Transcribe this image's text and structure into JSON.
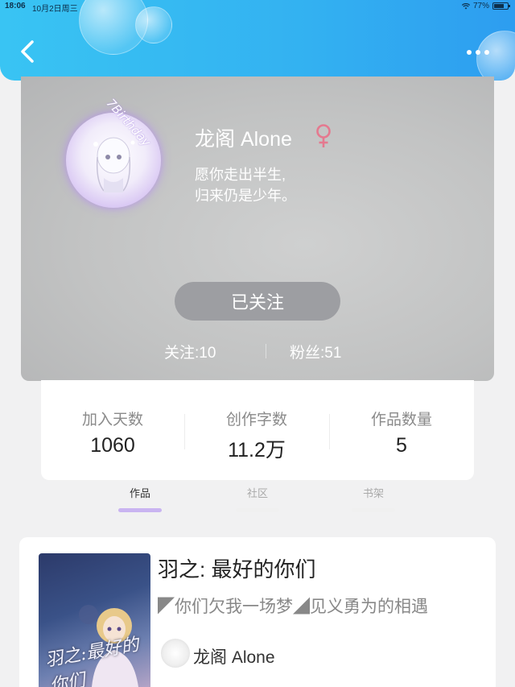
{
  "status_bar": {
    "time": "18:06",
    "date": "10月2日周三",
    "battery": "77%",
    "battery_level": 0.77
  },
  "header": {
    "back_icon": "chevron-left-icon",
    "more_icon": "more-dots-icon",
    "accent_color": "#35b6f2"
  },
  "profile": {
    "avatar_frame_text": "7Birthday",
    "username": "龙阁 Alone",
    "gender_icon": "female-icon",
    "gender_color": "#e5798f",
    "bio_line1": "愿你走出半生,",
    "bio_line2": "归来仍是少年。",
    "follow_button": "已关注",
    "following_label": "关注:10",
    "fans_label": "粉丝:51"
  },
  "stats": [
    {
      "label": "加入天数",
      "value": "1060"
    },
    {
      "label": "创作字数",
      "value": "11.2万"
    },
    {
      "label": "作品数量",
      "value": "5"
    }
  ],
  "tabs": [
    {
      "label": "作品",
      "active": true
    },
    {
      "label": "社区",
      "active": false
    },
    {
      "label": "书架",
      "active": false
    }
  ],
  "work": {
    "cover_text": "羽之:最好的你们",
    "title": "羽之: 最好的你们",
    "description": "◤你们欠我一场梦◢见义勇为的相遇",
    "author": "龙阁 Alone"
  }
}
